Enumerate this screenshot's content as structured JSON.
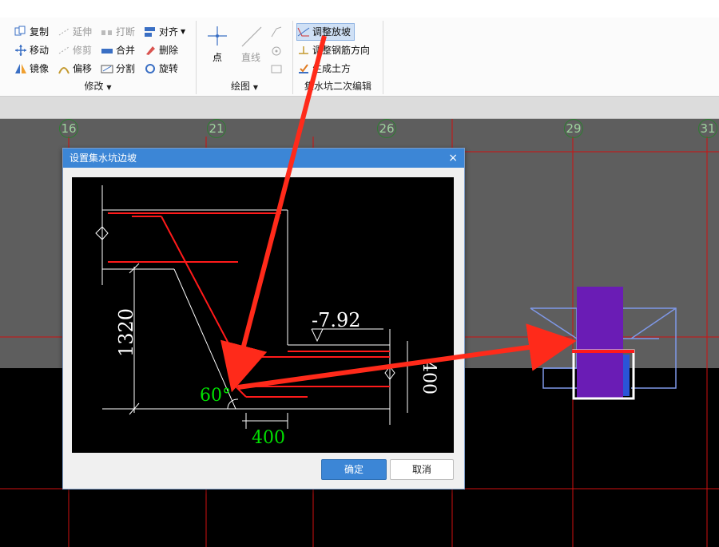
{
  "ribbon": {
    "modify": {
      "label": "修改",
      "tools": {
        "copy": "复制",
        "extend": "延伸",
        "break": "打断",
        "align": "对齐",
        "move": "移动",
        "trim": "修剪",
        "merge": "合并",
        "delete": "删除",
        "mirror": "镜像",
        "offset": "偏移",
        "split": "分割",
        "rotate": "旋转"
      }
    },
    "draw": {
      "label": "绘图",
      "point": "点",
      "line": "直线"
    },
    "pit": {
      "label": "集水坑二次编辑",
      "adjust_slope": "调整放坡",
      "adjust_rebar": "调整钢筋方向",
      "generate_earthwork": "生成土方"
    }
  },
  "axes": [
    "16",
    "21",
    "26",
    "29",
    "31"
  ],
  "dialog": {
    "title": "设置集水坑边坡",
    "close": "×",
    "ok": "确定",
    "cancel": "取消",
    "drawing": {
      "elevation": "-7.92",
      "depth": "1320",
      "angle": "60°",
      "width": "400",
      "thickness": "400"
    }
  },
  "colors": {
    "accent": "#3c86d6",
    "grid_red": "#d01010",
    "pit_purple": "#6a1cb5",
    "outline_blue": "#7f98e8",
    "annotation_arrow": "#ff2a1a",
    "dim_green": "#00e000"
  }
}
